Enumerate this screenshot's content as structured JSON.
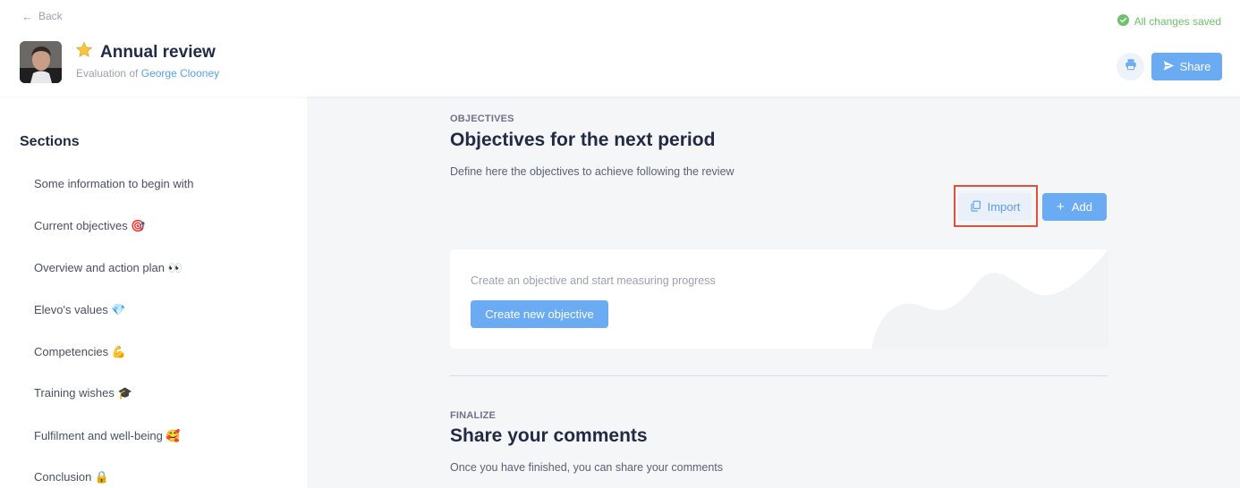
{
  "header": {
    "back_label": "Back",
    "title_emoji": "⭐",
    "title": "Annual review",
    "subtitle_prefix": "Evaluation of",
    "subtitle_person": "George Clooney",
    "save_status": "All changes saved",
    "share_label": "Share"
  },
  "sidebar": {
    "title": "Sections",
    "items": [
      {
        "label": "Some information to begin with"
      },
      {
        "label": "Current objectives 🎯"
      },
      {
        "label": "Overview and action plan 👀"
      },
      {
        "label": "Elevo's values 💎"
      },
      {
        "label": "Competencies 💪"
      },
      {
        "label": "Training wishes 🎓"
      },
      {
        "label": "Fulfilment and well-being 🥰"
      },
      {
        "label": "Conclusion 🔒"
      }
    ]
  },
  "objectives": {
    "eyebrow": "OBJECTIVES",
    "title": "Objectives for the next period",
    "description": "Define here the objectives to achieve following the review",
    "import_label": "Import",
    "add_label": "Add",
    "empty_text": "Create an objective and start measuring progress",
    "create_label": "Create new objective"
  },
  "finalize": {
    "eyebrow": "FINALIZE",
    "title": "Share your comments",
    "description": "Once you have finished, you can share your comments"
  },
  "colors": {
    "accent": "#6aabf3",
    "link": "#5aa0ec",
    "success": "#6cc26a",
    "highlight": "#e0503a",
    "main_bg": "#f4f6f8"
  }
}
